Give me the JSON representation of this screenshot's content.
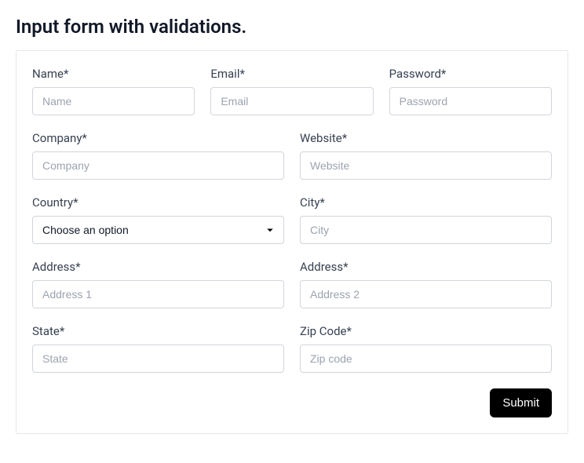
{
  "title": "Input form with validations.",
  "form": {
    "name": {
      "label": "Name*",
      "placeholder": "Name",
      "value": ""
    },
    "email": {
      "label": "Email*",
      "placeholder": "Email",
      "value": ""
    },
    "password": {
      "label": "Password*",
      "placeholder": "Password",
      "value": ""
    },
    "company": {
      "label": "Company*",
      "placeholder": "Company",
      "value": ""
    },
    "website": {
      "label": "Website*",
      "placeholder": "Website",
      "value": ""
    },
    "country": {
      "label": "Country*",
      "selected": "Choose an option"
    },
    "city": {
      "label": "City*",
      "placeholder": "City",
      "value": ""
    },
    "address1": {
      "label": "Address*",
      "placeholder": "Address 1",
      "value": ""
    },
    "address2": {
      "label": "Address*",
      "placeholder": "Address 2",
      "value": ""
    },
    "state": {
      "label": "State*",
      "placeholder": "State",
      "value": ""
    },
    "zip": {
      "label": "Zip Code*",
      "placeholder": "Zip code",
      "value": ""
    },
    "submit_label": "Submit"
  }
}
